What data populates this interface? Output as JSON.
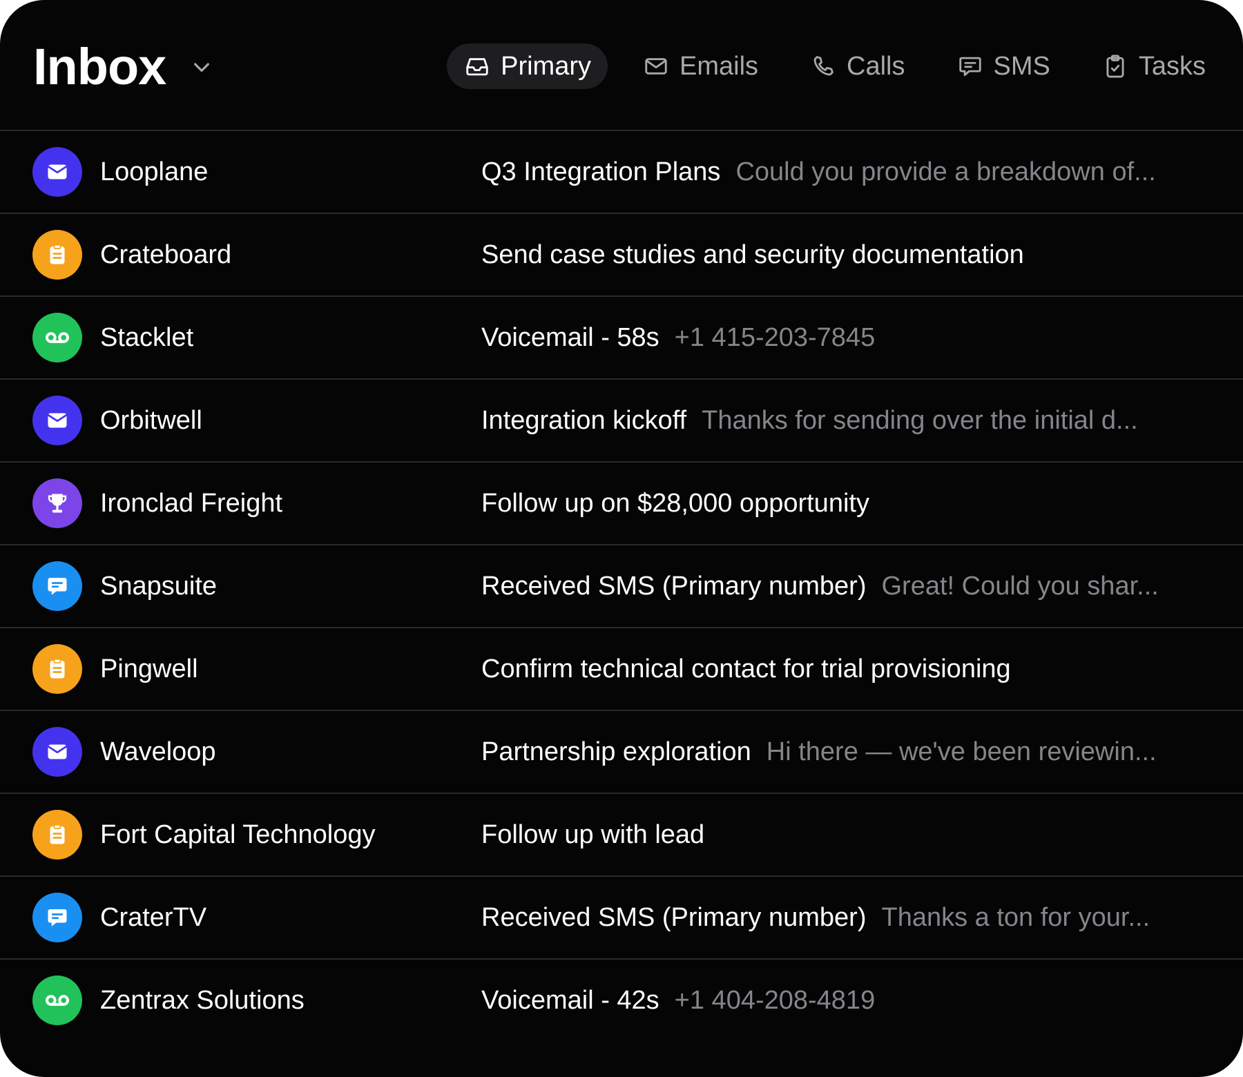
{
  "header": {
    "title": "Inbox",
    "title_chevron_icon": "chevron-down-icon",
    "tabs": [
      {
        "label": "Primary",
        "icon": "inbox-tray-icon",
        "active": true
      },
      {
        "label": "Emails",
        "icon": "envelope-icon",
        "active": false
      },
      {
        "label": "Calls",
        "icon": "phone-icon",
        "active": false
      },
      {
        "label": "SMS",
        "icon": "chat-bubble-icon",
        "active": false
      },
      {
        "label": "Tasks",
        "icon": "clipboard-check-icon",
        "active": false
      }
    ]
  },
  "colors": {
    "background": "#050505",
    "divider": "#2a2a2c",
    "active_tab_bg": "#1e1e21",
    "email": "#4433ee",
    "task": "#f7a21b",
    "voicemail": "#22c25a",
    "deal": "#7d45e8",
    "sms": "#1a8ff2"
  },
  "messages": [
    {
      "name": "Looplane",
      "type": "email",
      "icon": "envelope-icon",
      "subject": "Q3 Integration Plans",
      "preview": "Could you provide a breakdown of..."
    },
    {
      "name": "Crateboard",
      "type": "task",
      "icon": "clipboard-icon",
      "subject": "Send case studies and security documentation",
      "preview": ""
    },
    {
      "name": "Stacklet",
      "type": "voicemail",
      "icon": "voicemail-icon",
      "subject": "Voicemail - 58s",
      "preview": "+1 415-203-7845"
    },
    {
      "name": "Orbitwell",
      "type": "email",
      "icon": "envelope-icon",
      "subject": "Integration kickoff",
      "preview": "Thanks for sending over the initial d..."
    },
    {
      "name": "Ironclad Freight",
      "type": "deal",
      "icon": "trophy-icon",
      "subject": "Follow up on $28,000 opportunity",
      "preview": ""
    },
    {
      "name": "Snapsuite",
      "type": "sms",
      "icon": "chat-bubble-icon",
      "subject": "Received SMS (Primary number)",
      "preview": "Great! Could you shar..."
    },
    {
      "name": "Pingwell",
      "type": "task",
      "icon": "clipboard-icon",
      "subject": "Confirm technical contact for trial provisioning",
      "preview": ""
    },
    {
      "name": "Waveloop",
      "type": "email",
      "icon": "envelope-icon",
      "subject": "Partnership exploration",
      "preview": "Hi there — we've been reviewin..."
    },
    {
      "name": "Fort Capital Technology",
      "type": "task",
      "icon": "clipboard-icon",
      "subject": "Follow up with lead",
      "preview": ""
    },
    {
      "name": "CraterTV",
      "type": "sms",
      "icon": "chat-bubble-icon",
      "subject": "Received SMS (Primary number)",
      "preview": "Thanks a ton for your..."
    },
    {
      "name": "Zentrax Solutions",
      "type": "voicemail",
      "icon": "voicemail-icon",
      "subject": "Voicemail - 42s",
      "preview": "+1 404-208-4819"
    }
  ]
}
